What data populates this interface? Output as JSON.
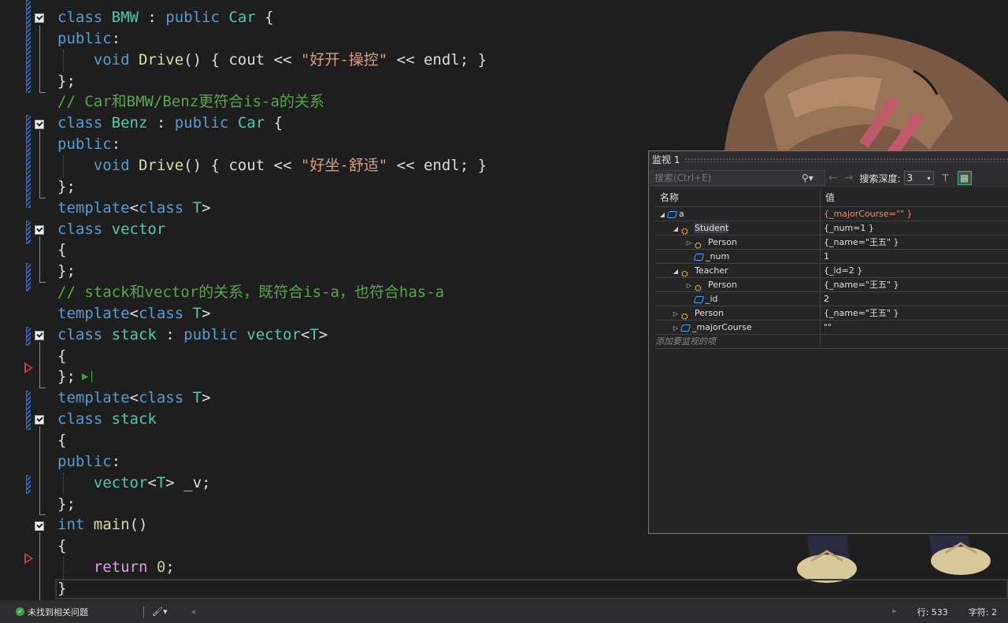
{
  "code": {
    "lines": [
      {
        "tokens": [
          {
            "t": "class",
            "c": "kw"
          },
          {
            "t": " BMW",
            "c": "ty"
          },
          {
            "t": " : ",
            "c": "pl"
          },
          {
            "t": "public",
            "c": "kw"
          },
          {
            "t": " Car",
            "c": "ty"
          },
          {
            "t": " {",
            "c": "pl"
          }
        ]
      },
      {
        "tokens": [
          {
            "t": "public",
            "c": "kw"
          },
          {
            "t": ":",
            "c": "pl"
          }
        ]
      },
      {
        "tokens": [
          {
            "t": "    void",
            "c": "kw"
          },
          {
            "t": " Drive",
            "c": "fn"
          },
          {
            "t": "() { cout << ",
            "c": "pl"
          },
          {
            "t": "\"好开-操控\"",
            "c": "str"
          },
          {
            "t": " << endl; }",
            "c": "pl"
          }
        ]
      },
      {
        "tokens": [
          {
            "t": "};",
            "c": "pl"
          }
        ]
      },
      {
        "tokens": [
          {
            "t": "// Car和BMW/Benz更符合is-a的关系",
            "c": "cm"
          }
        ]
      },
      {
        "tokens": [
          {
            "t": "class",
            "c": "kw"
          },
          {
            "t": " Benz",
            "c": "ty"
          },
          {
            "t": " : ",
            "c": "pl"
          },
          {
            "t": "public",
            "c": "kw"
          },
          {
            "t": " Car",
            "c": "ty"
          },
          {
            "t": " {",
            "c": "pl"
          }
        ]
      },
      {
        "tokens": [
          {
            "t": "public",
            "c": "kw"
          },
          {
            "t": ":",
            "c": "pl"
          }
        ]
      },
      {
        "tokens": [
          {
            "t": "    void",
            "c": "kw"
          },
          {
            "t": " Drive",
            "c": "fn"
          },
          {
            "t": "() { cout << ",
            "c": "pl"
          },
          {
            "t": "\"好坐-舒适\"",
            "c": "str"
          },
          {
            "t": " << endl; }",
            "c": "pl"
          }
        ]
      },
      {
        "tokens": [
          {
            "t": "};",
            "c": "pl"
          }
        ]
      },
      {
        "tokens": [
          {
            "t": "template",
            "c": "kw"
          },
          {
            "t": "<",
            "c": "pl"
          },
          {
            "t": "class",
            "c": "kw"
          },
          {
            "t": " T",
            "c": "ty"
          },
          {
            "t": ">",
            "c": "pl"
          }
        ]
      },
      {
        "tokens": [
          {
            "t": "class",
            "c": "kw"
          },
          {
            "t": " vector",
            "c": "ty"
          }
        ]
      },
      {
        "tokens": [
          {
            "t": "{",
            "c": "pl"
          }
        ]
      },
      {
        "tokens": [
          {
            "t": "};",
            "c": "pl"
          }
        ]
      },
      {
        "tokens": [
          {
            "t": "// stack和vector的关系，既符合is-a，也符合has-a",
            "c": "cm"
          }
        ]
      },
      {
        "tokens": [
          {
            "t": "template",
            "c": "kw"
          },
          {
            "t": "<",
            "c": "pl"
          },
          {
            "t": "class",
            "c": "kw"
          },
          {
            "t": " T",
            "c": "ty"
          },
          {
            "t": ">",
            "c": "pl"
          }
        ]
      },
      {
        "tokens": [
          {
            "t": "class",
            "c": "kw"
          },
          {
            "t": " stack",
            "c": "ty"
          },
          {
            "t": " : ",
            "c": "pl"
          },
          {
            "t": "public",
            "c": "kw"
          },
          {
            "t": " vector",
            "c": "ty"
          },
          {
            "t": "<",
            "c": "pl"
          },
          {
            "t": "T",
            "c": "ty"
          },
          {
            "t": ">",
            "c": "pl"
          }
        ]
      },
      {
        "tokens": [
          {
            "t": "{",
            "c": "pl"
          }
        ]
      },
      {
        "tokens": [
          {
            "t": "};",
            "c": "pl"
          }
        ],
        "run_glyph": "▶|"
      },
      {
        "tokens": [
          {
            "t": "template",
            "c": "kw"
          },
          {
            "t": "<",
            "c": "pl"
          },
          {
            "t": "class",
            "c": "kw"
          },
          {
            "t": " T",
            "c": "ty"
          },
          {
            "t": ">",
            "c": "pl"
          }
        ]
      },
      {
        "tokens": [
          {
            "t": "class",
            "c": "kw"
          },
          {
            "t": " stack",
            "c": "ty"
          }
        ]
      },
      {
        "tokens": [
          {
            "t": "{",
            "c": "pl"
          }
        ]
      },
      {
        "tokens": [
          {
            "t": "public",
            "c": "kw"
          },
          {
            "t": ":",
            "c": "pl"
          }
        ]
      },
      {
        "tokens": [
          {
            "t": "    vector",
            "c": "ty"
          },
          {
            "t": "<",
            "c": "pl"
          },
          {
            "t": "T",
            "c": "ty"
          },
          {
            "t": "> _v;",
            "c": "pl"
          }
        ]
      },
      {
        "tokens": [
          {
            "t": "};",
            "c": "pl"
          }
        ]
      },
      {
        "tokens": [
          {
            "t": "int",
            "c": "kw"
          },
          {
            "t": " main",
            "c": "fn"
          },
          {
            "t": "()",
            "c": "pl"
          }
        ]
      },
      {
        "tokens": [
          {
            "t": "{",
            "c": "pl"
          }
        ]
      },
      {
        "tokens": [
          {
            "t": "    return",
            "c": "kw2"
          },
          {
            "t": " 0",
            "c": "num"
          },
          {
            "t": ";",
            "c": "pl"
          }
        ]
      },
      {
        "tokens": [
          {
            "t": "}",
            "c": "pl"
          }
        ]
      }
    ]
  },
  "watch": {
    "title": "监视 1",
    "search_placeholder": "搜索(Ctrl+E)",
    "search_icon": "search-icon",
    "depth_label": "搜索深度:",
    "depth_value": "3",
    "col_name": "名称",
    "col_value": "值",
    "rows": [
      {
        "indent": 0,
        "tri": "◢",
        "icon": "var",
        "name": "a",
        "value": "{_majorCourse=\"\" }",
        "changed": true,
        "selected": false
      },
      {
        "indent": 1,
        "tri": "◢",
        "icon": "class",
        "name": "Student",
        "value": "{_num=1 }",
        "changed": false,
        "selected": true
      },
      {
        "indent": 2,
        "tri": "▷",
        "icon": "class",
        "name": "Person",
        "value": "{_name=\"王五\" }",
        "changed": false,
        "selected": false
      },
      {
        "indent": 2,
        "tri": "",
        "icon": "var",
        "name": "_num",
        "value": "1",
        "changed": false,
        "selected": false
      },
      {
        "indent": 1,
        "tri": "◢",
        "icon": "class",
        "name": "Teacher",
        "value": "{_id=2 }",
        "changed": false,
        "selected": false
      },
      {
        "indent": 2,
        "tri": "▷",
        "icon": "class",
        "name": "Person",
        "value": "{_name=\"王五\" }",
        "changed": false,
        "selected": false
      },
      {
        "indent": 2,
        "tri": "",
        "icon": "var",
        "name": "_id",
        "value": "2",
        "changed": false,
        "selected": false
      },
      {
        "indent": 1,
        "tri": "▷",
        "icon": "class",
        "name": "Person",
        "value": "{_name=\"王五\" }",
        "changed": false,
        "selected": false
      },
      {
        "indent": 1,
        "tri": "▷",
        "icon": "var",
        "name": "_majorCourse",
        "value": "\"\"",
        "changed": false,
        "selected": false
      }
    ],
    "add_placeholder": "添加要监视的项"
  },
  "status": {
    "issues": "未找到相关问题",
    "line": "行: 533",
    "char": "字符: 2"
  },
  "colors": {
    "accent": "#569cd6",
    "type": "#4ec9b0",
    "string": "#d69d85",
    "comment": "#57a64a"
  }
}
